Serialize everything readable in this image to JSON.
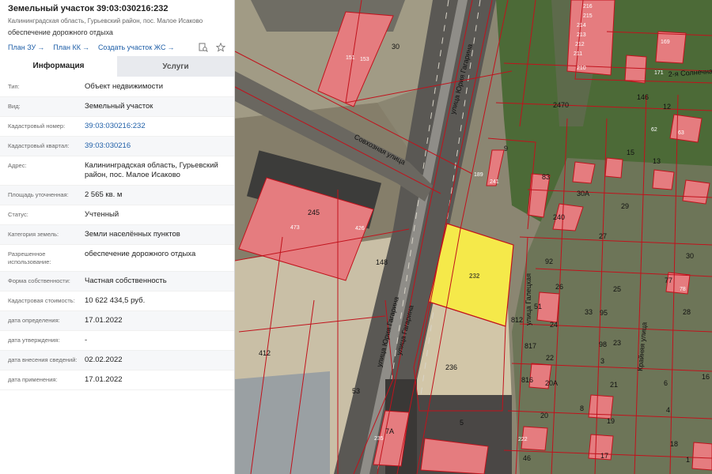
{
  "header": {
    "title": "Земельный участок 39:03:030216:232",
    "address": "Калининградская область, Гурьевский район, пос. Малое Исаково",
    "purpose": "обеспечение дорожного отдыха",
    "links": [
      "План ЗУ",
      "План КК",
      "Создать участок ЖС"
    ],
    "icons": [
      "search-page-icon",
      "star-icon"
    ]
  },
  "tabs": [
    "Информация",
    "Услуги"
  ],
  "rows": [
    {
      "k": "Тип:",
      "v": "Объект недвижимости"
    },
    {
      "k": "Вид:",
      "v": "Земельный участок"
    },
    {
      "k": "Кадастровый номер:",
      "v": "39:03:030216:232"
    },
    {
      "k": "Кадастровый квартал:",
      "v": "39:03:030216"
    },
    {
      "k": "Адрес:",
      "v": "Калининградская область, Гурьевский район, пос. Малое Исаково"
    },
    {
      "k": "Площадь уточненная:",
      "v": "2 565 кв. м"
    },
    {
      "k": "Статус:",
      "v": "Учтенный"
    },
    {
      "k": "Категория земель:",
      "v": "Земли населённых пунктов"
    },
    {
      "k": "Разрешенное использование:",
      "v": "обеспечение дорожного отдыха"
    },
    {
      "k": "Форма собственности:",
      "v": "Частная собственность"
    },
    {
      "k": "Кадастровая стоимость:",
      "v": "10 622 434,5 руб."
    },
    {
      "k": "дата определения:",
      "v": "17.01.2022"
    },
    {
      "k": "дата утверждения:",
      "v": "-"
    },
    {
      "k": "дата внесения сведений:",
      "v": "02.02.2022"
    },
    {
      "k": "дата применения:",
      "v": "17.01.2022"
    }
  ],
  "map": {
    "streets": [
      "улица Юрия Гагарина",
      "Совхозная улица",
      "улица Гагарина",
      "2-я Солнечная",
      "улица Галецкая",
      "Крайняя улица"
    ],
    "selected_parcel": "232",
    "parcel_numbers": [
      "151",
      "153",
      "30",
      "245",
      "426",
      "473",
      "148",
      "412",
      "236",
      "2470",
      "189",
      "241",
      "83",
      "240",
      "9",
      "30A",
      "15",
      "13",
      "29",
      "27",
      "26",
      "25",
      "24",
      "22",
      "20A",
      "21",
      "20",
      "19",
      "17",
      "7A",
      "235",
      "5",
      "222",
      "46",
      "18",
      "216",
      "215",
      "214",
      "213",
      "212",
      "211",
      "210",
      "12",
      "169",
      "171",
      "146",
      "62",
      "63",
      "78",
      "77",
      "28",
      "30",
      "33",
      "95",
      "98",
      "23",
      "817",
      "816",
      "812",
      "92",
      "51",
      "3",
      "8",
      "4",
      "6",
      "16",
      "1",
      "53"
    ],
    "colors": {
      "parcel": "#e57c7f",
      "border": "#c1121c",
      "selected": "#f5e94a"
    }
  }
}
